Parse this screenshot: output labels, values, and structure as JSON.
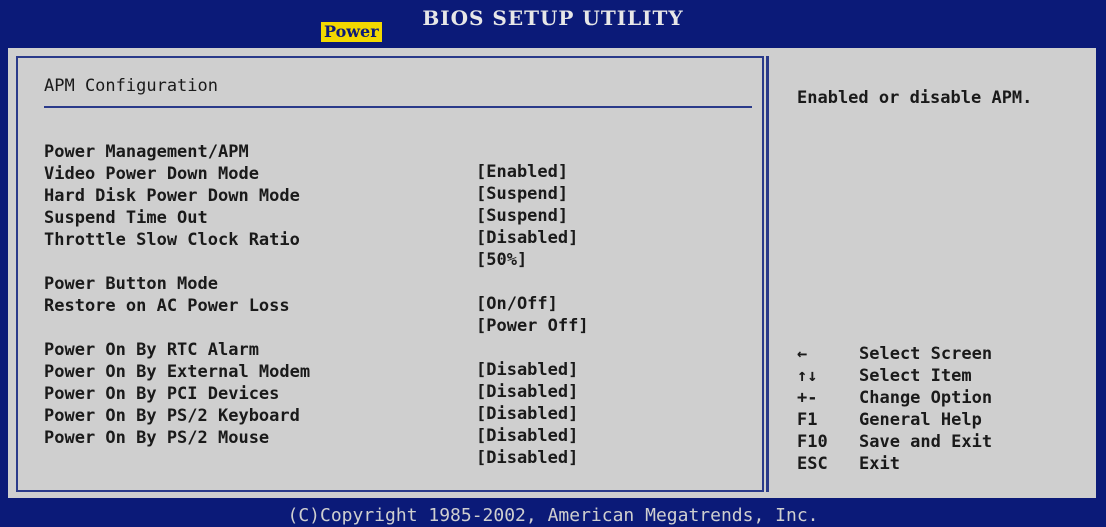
{
  "header": {
    "title": "BIOS SETUP UTILITY",
    "active_tab": "Power"
  },
  "section": {
    "title": "APM Configuration"
  },
  "settings": [
    {
      "label": "Power Management/APM",
      "value": "[Enabled]"
    },
    {
      "label": "Video Power Down Mode",
      "value": "[Suspend]"
    },
    {
      "label": "Hard Disk Power Down Mode",
      "value": "[Suspend]"
    },
    {
      "label": "Suspend Time Out",
      "value": "[Disabled]"
    },
    {
      "label": "Throttle Slow Clock Ratio",
      "value": "[50%]"
    },
    {
      "label": "Power Button Mode",
      "value": "[On/Off]"
    },
    {
      "label": "Restore on AC Power Loss",
      "value": "[Power Off]"
    },
    {
      "label": "Power On By RTC Alarm",
      "value": "[Disabled]"
    },
    {
      "label": "Power On By External Modem",
      "value": "[Disabled]"
    },
    {
      "label": "Power On By PCI Devices",
      "value": "[Disabled]"
    },
    {
      "label": "Power On By PS/2 Keyboard",
      "value": "[Disabled]"
    },
    {
      "label": "Power On By PS/2 Mouse",
      "value": "[Disabled]"
    }
  ],
  "help": {
    "text": "Enabled or disable APM."
  },
  "keys": [
    {
      "key": "←",
      "desc": "Select Screen",
      "icon": "left-arrow-icon"
    },
    {
      "key": "↑↓",
      "desc": "Select Item",
      "icon": "up-down-arrow-icon"
    },
    {
      "key": "+-",
      "desc": "Change Option"
    },
    {
      "key": "F1",
      "desc": "General Help"
    },
    {
      "key": "F10",
      "desc": "Save and Exit"
    },
    {
      "key": "ESC",
      "desc": "Exit"
    }
  ],
  "footer": {
    "copyright": "(C)Copyright 1985-2002, American Megatrends, Inc."
  },
  "colors": {
    "background": "#0b1a78",
    "panel": "#cfcfcf",
    "tab_highlight": "#f2d800"
  }
}
